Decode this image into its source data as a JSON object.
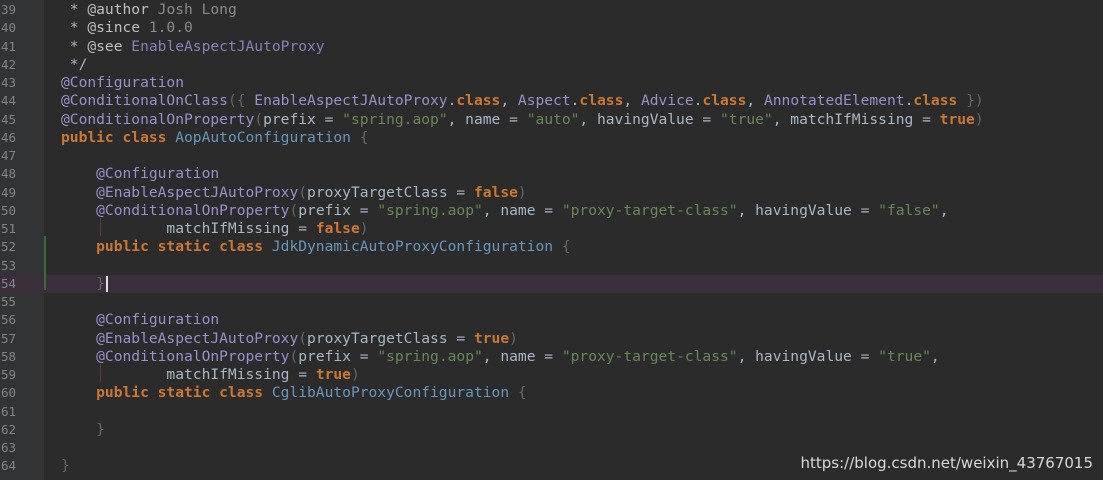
{
  "editor": {
    "lines": [
      {
        "num": "39",
        "tokens": [
          {
            "t": " * ",
            "c": "t-doc"
          },
          {
            "t": "@author",
            "c": "t-doc-tag"
          },
          {
            "t": " Josh Long",
            "c": "t-doc-text"
          }
        ]
      },
      {
        "num": "40",
        "tokens": [
          {
            "t": " * ",
            "c": "t-doc"
          },
          {
            "t": "@since",
            "c": "t-doc-tag"
          },
          {
            "t": " 1.0.0",
            "c": "t-doc-text"
          }
        ]
      },
      {
        "num": "41",
        "tokens": [
          {
            "t": " * ",
            "c": "t-doc"
          },
          {
            "t": "@see",
            "c": "t-doc-tag"
          },
          {
            "t": " EnableAspectJAutoProxy",
            "c": "t-doc-link"
          }
        ]
      },
      {
        "num": "42",
        "tokens": [
          {
            "t": " */",
            "c": "t-doc"
          }
        ]
      },
      {
        "num": "43",
        "tokens": [
          {
            "t": "@Configuration",
            "c": "t-anno2"
          }
        ]
      },
      {
        "num": "44",
        "tokens": [
          {
            "t": "@ConditionalOnClass",
            "c": "t-anno2"
          },
          {
            "t": "({ ",
            "c": "t-brace"
          },
          {
            "t": "EnableAspectJAutoProxy",
            "c": "t-anno2"
          },
          {
            "t": ".",
            "c": "t-plain"
          },
          {
            "t": "class",
            "c": "t-kw"
          },
          {
            "t": ", ",
            "c": "t-plain"
          },
          {
            "t": "Aspect",
            "c": "t-anno2"
          },
          {
            "t": ".",
            "c": "t-plain"
          },
          {
            "t": "class",
            "c": "t-kw"
          },
          {
            "t": ", ",
            "c": "t-plain"
          },
          {
            "t": "Advice",
            "c": "t-anno2"
          },
          {
            "t": ".",
            "c": "t-plain"
          },
          {
            "t": "class",
            "c": "t-kw"
          },
          {
            "t": ", ",
            "c": "t-plain"
          },
          {
            "t": "AnnotatedElement",
            "c": "t-anno2"
          },
          {
            "t": ".",
            "c": "t-plain"
          },
          {
            "t": "class",
            "c": "t-kw"
          },
          {
            "t": " })",
            "c": "t-brace"
          }
        ]
      },
      {
        "num": "45",
        "tokens": [
          {
            "t": "@ConditionalOnProperty",
            "c": "t-anno2"
          },
          {
            "t": "(",
            "c": "t-brace"
          },
          {
            "t": "prefix = ",
            "c": "t-plain"
          },
          {
            "t": "\"spring.aop\"",
            "c": "t-str"
          },
          {
            "t": ", name = ",
            "c": "t-plain"
          },
          {
            "t": "\"auto\"",
            "c": "t-str"
          },
          {
            "t": ", havingValue = ",
            "c": "t-plain"
          },
          {
            "t": "\"true\"",
            "c": "t-str"
          },
          {
            "t": ", matchIfMissing = ",
            "c": "t-plain"
          },
          {
            "t": "true",
            "c": "t-kw"
          },
          {
            "t": ")",
            "c": "t-brace"
          }
        ]
      },
      {
        "num": "46",
        "tokens": [
          {
            "t": "public class ",
            "c": "t-kw"
          },
          {
            "t": "AopAutoConfiguration",
            "c": "t-cls"
          },
          {
            "t": " {",
            "c": "t-brace"
          }
        ]
      },
      {
        "num": "47",
        "tokens": []
      },
      {
        "num": "48",
        "tokens": [
          {
            "t": "    @Configuration",
            "c": "t-anno2"
          }
        ]
      },
      {
        "num": "49",
        "tokens": [
          {
            "t": "    @EnableAspectJAutoProxy",
            "c": "t-anno2"
          },
          {
            "t": "(",
            "c": "t-brace"
          },
          {
            "t": "proxyTargetClass = ",
            "c": "t-plain"
          },
          {
            "t": "false",
            "c": "t-kw"
          },
          {
            "t": ")",
            "c": "t-brace"
          }
        ]
      },
      {
        "num": "50",
        "tokens": [
          {
            "t": "    @ConditionalOnProperty",
            "c": "t-anno2"
          },
          {
            "t": "(",
            "c": "t-brace"
          },
          {
            "t": "prefix = ",
            "c": "t-plain"
          },
          {
            "t": "\"spring.aop\"",
            "c": "t-str"
          },
          {
            "t": ", name = ",
            "c": "t-plain"
          },
          {
            "t": "\"proxy-target-class\"",
            "c": "t-str"
          },
          {
            "t": ", havingValue = ",
            "c": "t-plain"
          },
          {
            "t": "\"false\"",
            "c": "t-str"
          },
          {
            "t": ",",
            "c": "t-plain"
          }
        ]
      },
      {
        "num": "51",
        "tokens": [
          {
            "t": "            matchIfMissing = ",
            "c": "t-plain"
          },
          {
            "t": "false",
            "c": "t-kw"
          },
          {
            "t": ")",
            "c": "t-brace"
          }
        ]
      },
      {
        "num": "52",
        "tokens": [
          {
            "t": "    public static class ",
            "c": "t-kw"
          },
          {
            "t": "JdkDynamicAutoProxyConfiguration",
            "c": "t-cls"
          },
          {
            "t": " {",
            "c": "t-brace"
          }
        ]
      },
      {
        "num": "53",
        "tokens": []
      },
      {
        "num": "54",
        "tokens": [
          {
            "t": "    }",
            "c": "t-brace"
          }
        ],
        "current": true
      },
      {
        "num": "55",
        "tokens": []
      },
      {
        "num": "56",
        "tokens": [
          {
            "t": "    @Configuration",
            "c": "t-anno2"
          }
        ]
      },
      {
        "num": "57",
        "tokens": [
          {
            "t": "    @EnableAspectJAutoProxy",
            "c": "t-anno2"
          },
          {
            "t": "(",
            "c": "t-brace"
          },
          {
            "t": "proxyTargetClass = ",
            "c": "t-plain"
          },
          {
            "t": "true",
            "c": "t-kw"
          },
          {
            "t": ")",
            "c": "t-brace"
          }
        ]
      },
      {
        "num": "58",
        "tokens": [
          {
            "t": "    @ConditionalOnProperty",
            "c": "t-anno2"
          },
          {
            "t": "(",
            "c": "t-brace"
          },
          {
            "t": "prefix = ",
            "c": "t-plain"
          },
          {
            "t": "\"spring.aop\"",
            "c": "t-str"
          },
          {
            "t": ", name = ",
            "c": "t-plain"
          },
          {
            "t": "\"proxy-target-class\"",
            "c": "t-str"
          },
          {
            "t": ", havingValue = ",
            "c": "t-plain"
          },
          {
            "t": "\"true\"",
            "c": "t-str"
          },
          {
            "t": ",",
            "c": "t-plain"
          }
        ]
      },
      {
        "num": "59",
        "tokens": [
          {
            "t": "            matchIfMissing = ",
            "c": "t-plain"
          },
          {
            "t": "true",
            "c": "t-kw"
          },
          {
            "t": ")",
            "c": "t-brace"
          }
        ]
      },
      {
        "num": "60",
        "tokens": [
          {
            "t": "    public static class ",
            "c": "t-kw"
          },
          {
            "t": "CglibAutoProxyConfiguration",
            "c": "t-cls"
          },
          {
            "t": " {",
            "c": "t-brace"
          }
        ]
      },
      {
        "num": "61",
        "tokens": []
      },
      {
        "num": "62",
        "tokens": [
          {
            "t": "    }",
            "c": "t-brace"
          }
        ]
      },
      {
        "num": "63",
        "tokens": []
      },
      {
        "num": "64",
        "tokens": [
          {
            "t": "}",
            "c": "t-brace"
          }
        ]
      }
    ]
  },
  "watermark": "https://blog.csdn.net/weixin_43767015"
}
